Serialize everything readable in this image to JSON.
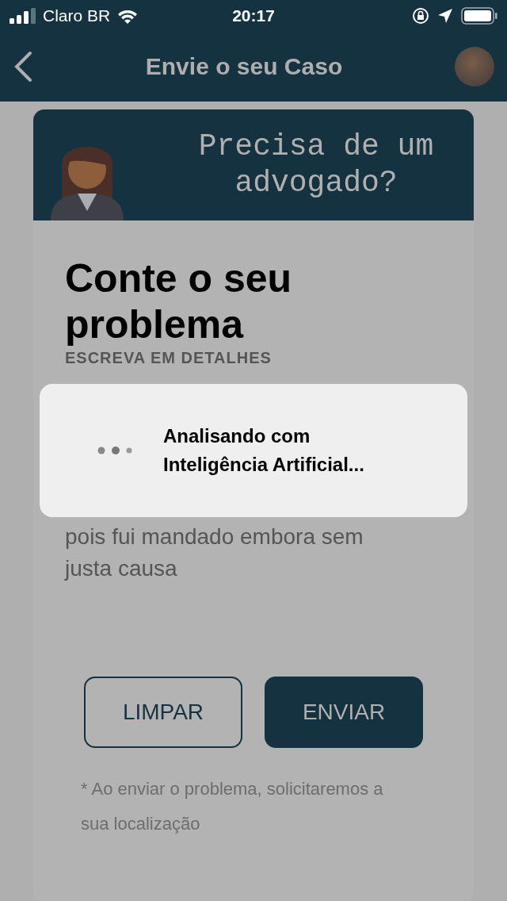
{
  "status_bar": {
    "carrier": "Claro BR",
    "time": "20:17"
  },
  "nav": {
    "title": "Envie o seu Caso"
  },
  "banner": {
    "headline": "Precisa de um advogado?"
  },
  "form": {
    "title": "Conte o seu problema",
    "subtitle": "ESCREVA EM DETALHES",
    "problem_text": "pois fui mandado embora sem justa causa"
  },
  "buttons": [
    {
      "label": "LIMPAR",
      "kind": "outline"
    },
    {
      "label": "ENVIAR",
      "kind": "filled"
    }
  ],
  "note": "* Ao enviar o problema, solicitaremos a sua localização",
  "loading": {
    "message": "Analisando com Inteligência Artificial..."
  }
}
